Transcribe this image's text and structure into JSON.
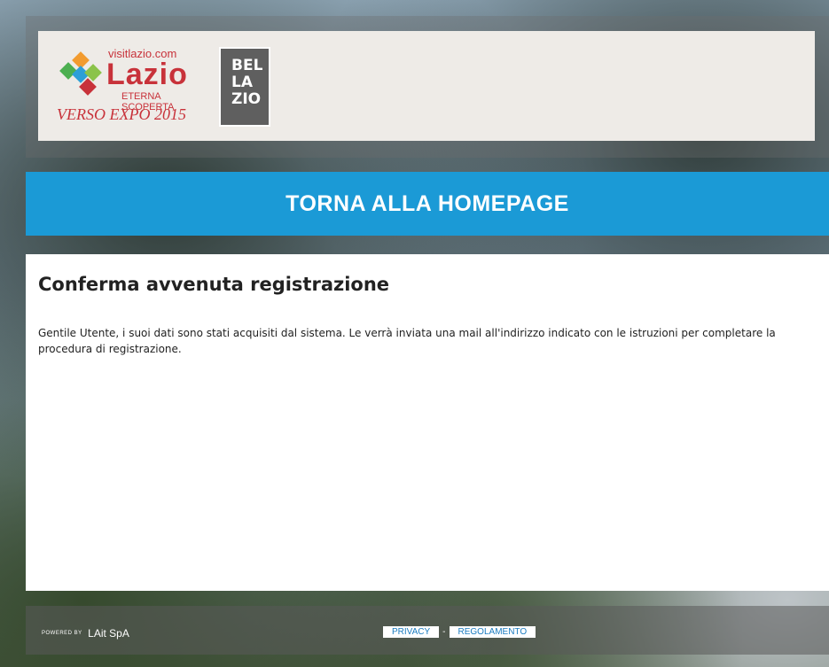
{
  "header": {
    "logo_lazio": {
      "site": "visitlazio.com",
      "name": "Lazio",
      "tagline": "ETERNA SCOPERTA",
      "expo": "VERSO EXPO 2015"
    },
    "logo_bellazio": {
      "lines": [
        "BEL",
        "LA",
        "ZIO"
      ]
    }
  },
  "home_link": {
    "label": "TORNA ALLA HOMEPAGE"
  },
  "main": {
    "title": "Conferma avvenuta registrazione",
    "message": "Gentile Utente, i suoi dati sono stati acquisiti dal sistema. Le verrà inviata una mail all'indirizzo indicato con le istruzioni per completare la procedura di registrazione."
  },
  "footer": {
    "powered_by": "POWERED BY",
    "company": "LAit SpA",
    "links": [
      "PRIVACY",
      "REGOLAMENTO"
    ],
    "separator": "-"
  },
  "colors": {
    "brand_blue": "#1b9ad6",
    "brand_red": "#c8323a",
    "logo_gray": "#5f5f5f"
  }
}
